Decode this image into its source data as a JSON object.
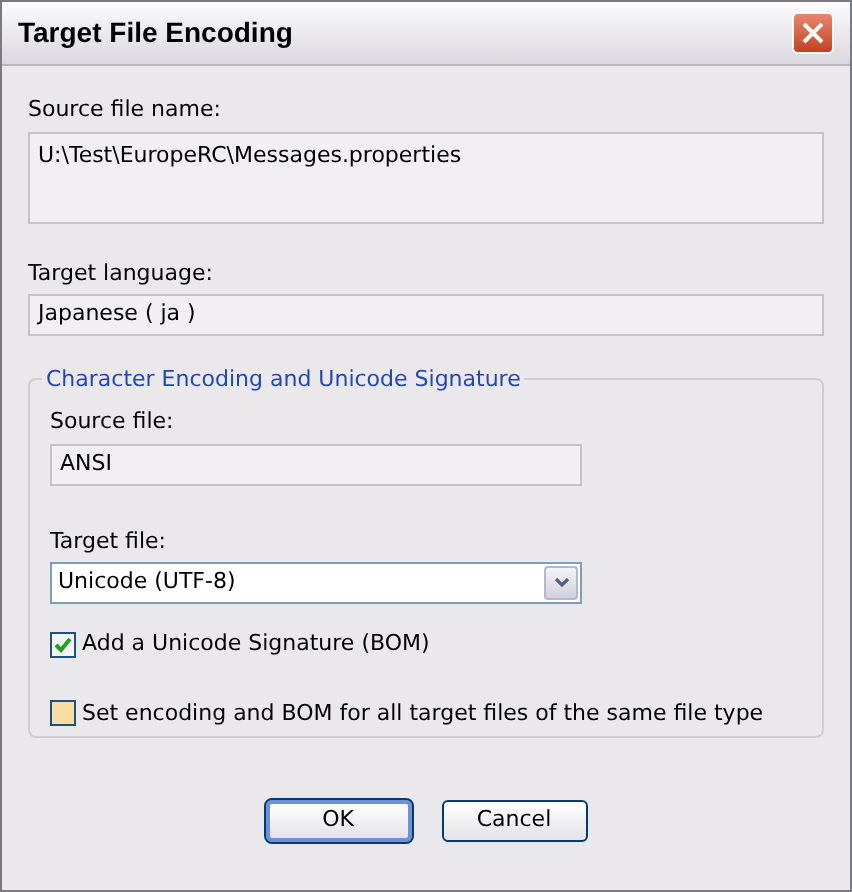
{
  "window": {
    "title": "Target File Encoding"
  },
  "source_file_name": {
    "label": "Source file name:",
    "value": "U:\\Test\\EuropeRC\\Messages.properties"
  },
  "target_language": {
    "label": "Target language:",
    "value": "Japanese ( ja )"
  },
  "group": {
    "title": "Character Encoding and Unicode Signature",
    "source_file": {
      "label": "Source file:",
      "value": "ANSI"
    },
    "target_file": {
      "label": "Target file:",
      "value": "Unicode (UTF-8)"
    },
    "checkboxes": [
      {
        "label": "Add a Unicode Signature (BOM)",
        "checked": true
      },
      {
        "label": "Set encoding and BOM for all target files of the same file type",
        "checked": false
      }
    ]
  },
  "buttons": [
    {
      "label": "OK",
      "default": true
    },
    {
      "label": "Cancel",
      "default": false
    }
  ]
}
